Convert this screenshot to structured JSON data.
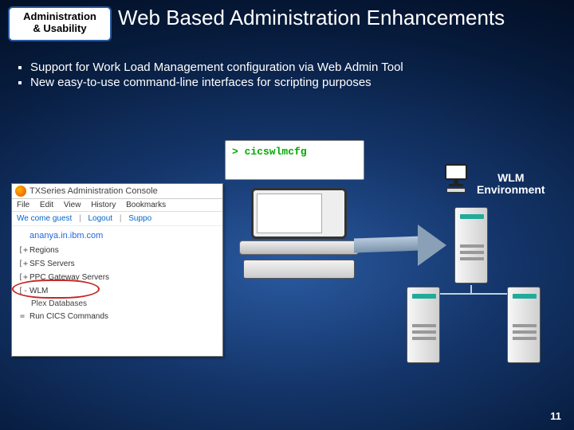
{
  "badge": {
    "line1": "Administration",
    "line2": "& Usability"
  },
  "title": "Web Based Administration Enhancements",
  "bullets": [
    "Support for Work Load Management configuration via Web Admin Tool",
    "New easy-to-use command-line interfaces for scripting purposes"
  ],
  "terminal": {
    "prompt": "> cicswlmcfg"
  },
  "wlm_label": {
    "line1": "WLM",
    "line2": "Environment"
  },
  "console": {
    "window_title": "TXSeries Administration Console",
    "menu": [
      "File",
      "Edit",
      "View",
      "History",
      "Bookmarks"
    ],
    "subbar": {
      "left": "We come guest",
      "logout": "Logout",
      "support": "Suppo"
    },
    "host": "ananya.in.ibm.com",
    "tree": [
      {
        "tw": "[+",
        "label": "Regions"
      },
      {
        "tw": "[+",
        "label": "SFS Servers"
      },
      {
        "tw": "[+",
        "label": "PPC Gateway Servers"
      },
      {
        "tw": "[-",
        "label": "WLM",
        "highlight": true
      },
      {
        "tw": "",
        "label": "Plex Databases",
        "sub": true
      },
      {
        "tw": "=",
        "label": "Run CICS Commands"
      }
    ]
  },
  "page_number": "11"
}
